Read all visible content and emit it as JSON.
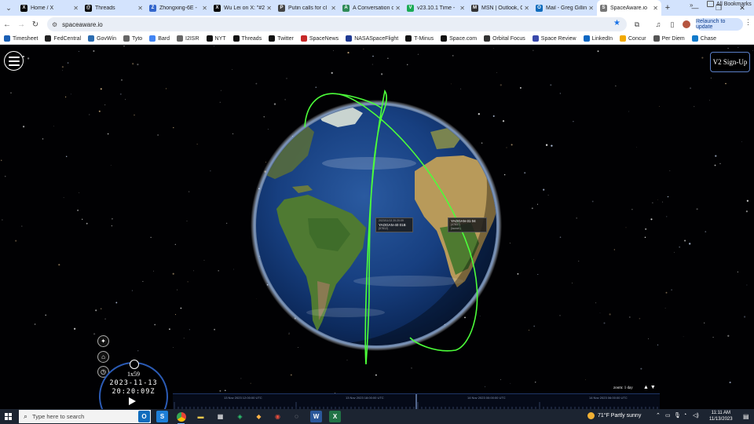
{
  "browser": {
    "tabs": [
      {
        "title": "Home / X",
        "fav": "X",
        "color": "#000000",
        "active": false
      },
      {
        "title": "Threads",
        "fav": "@",
        "color": "#000000",
        "active": false
      },
      {
        "title": "Zhongxing-6E -",
        "fav": "Z",
        "color": "#3366cc",
        "active": false
      },
      {
        "title": "Wu Lei on X: \"#2",
        "fav": "X",
        "color": "#000000",
        "active": false
      },
      {
        "title": "Putin calls for cl",
        "fav": "P",
        "color": "#444444",
        "active": false
      },
      {
        "title": "A Conversation o",
        "fav": "A",
        "color": "#2e8b57",
        "active": false
      },
      {
        "title": "v23.10.1 Time -",
        "fav": "V",
        "color": "#1aaa55",
        "active": false
      },
      {
        "title": "MSN | Outlook, C",
        "fav": "M",
        "color": "#333333",
        "active": false
      },
      {
        "title": "Mail - Greg Gillin",
        "fav": "O",
        "color": "#0f6cbd",
        "active": false
      },
      {
        "title": "SpaceAware.io",
        "fav": "S",
        "color": "#777777",
        "active": true
      }
    ],
    "url": "spaceaware.io",
    "relaunch_label": "Relaunch to update",
    "bookmarks": [
      {
        "label": "Timesheet",
        "color": "#1a5fb4"
      },
      {
        "label": "FedCentral",
        "color": "#222222"
      },
      {
        "label": "GovWin",
        "color": "#2b6cb0"
      },
      {
        "label": "Tyto",
        "color": "#666666"
      },
      {
        "label": "Bard",
        "color": "#4285f4"
      },
      {
        "label": "I2ISR",
        "color": "#666666"
      },
      {
        "label": "NYT",
        "color": "#111111"
      },
      {
        "label": "Threads",
        "color": "#111111"
      },
      {
        "label": "Twitter",
        "color": "#111111"
      },
      {
        "label": "SpaceNews",
        "color": "#c62828"
      },
      {
        "label": "NASASpaceFlight",
        "color": "#1f3a93"
      },
      {
        "label": "T-Minus",
        "color": "#111111"
      },
      {
        "label": "Space.com",
        "color": "#111111"
      },
      {
        "label": "Orbital Focus",
        "color": "#333333"
      },
      {
        "label": "Space Review",
        "color": "#3949ab"
      },
      {
        "label": "LinkedIn",
        "color": "#0a66c2"
      },
      {
        "label": "Concur",
        "color": "#f2a900"
      },
      {
        "label": "Per Diem",
        "color": "#555555"
      },
      {
        "label": "Chase",
        "color": "#117aca"
      }
    ],
    "all_bookmarks_label": "All Bookmarks"
  },
  "app": {
    "signup_label": "V2 Sign-Up",
    "satellites": [
      {
        "small": "2023/11/13 20:20:09",
        "name": "YAOGAN-40 01B",
        "id": "(57812)"
      },
      {
        "small": "",
        "name": "YAOGAN-31 04",
        "id": "(47837)",
        "extra": "(launch)"
      }
    ],
    "clock": {
      "rate": "1x59",
      "date": "2023-11-13",
      "time": "20:20:09Z"
    },
    "timeline_labels": [
      "13 Nov 2023 12:00:00 UTC",
      "13 Nov 2023 18:00:00 UTC",
      "14 Nov 2023 00:00:00 UTC",
      "14 Nov 2023 06:00:00 UTC"
    ],
    "zoom_label": "zoom: 1 day"
  },
  "taskbar": {
    "search_placeholder": "Type here to search",
    "weather": "71°F  Partly sunny",
    "time": "11:11 AM",
    "date": "11/13/2023"
  },
  "colors": {
    "orbit": "#4cff3a",
    "tabstrip": "#d3e3fd",
    "taskbar": "#1c2431"
  }
}
